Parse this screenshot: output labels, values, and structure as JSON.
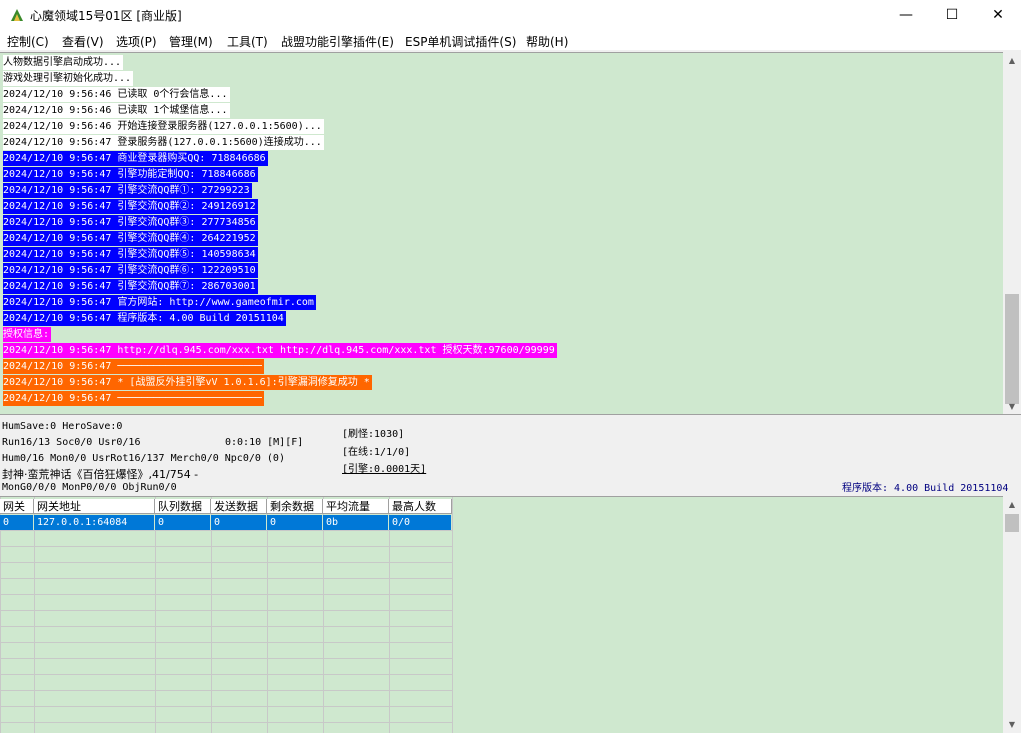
{
  "window": {
    "title": "心魔领域15号01区 [商业版]",
    "minimize": "—",
    "maximize": "☐",
    "close": "✕"
  },
  "menu": [
    "控制(C)",
    "查看(V)",
    "选项(P)",
    "管理(M)",
    "工具(T)",
    "战盟功能引擎插件(E)",
    "ESP单机调试插件(S)",
    "帮助(H)"
  ],
  "log": [
    {
      "text": "人物数据引擎启动成功...",
      "bg": "#ffffff",
      "fg": "#000000"
    },
    {
      "text": "游戏处理引擎初始化成功...",
      "bg": "#ffffff",
      "fg": "#000000"
    },
    {
      "text": "2024/12/10 9:56:46 已读取 0个行会信息...",
      "bg": "#ffffff",
      "fg": "#000000"
    },
    {
      "text": "2024/12/10 9:56:46 已读取 1个城堡信息...",
      "bg": "#ffffff",
      "fg": "#000000"
    },
    {
      "text": "2024/12/10 9:56:46 开始连接登录服务器(127.0.0.1:5600)...",
      "bg": "#ffffff",
      "fg": "#000000"
    },
    {
      "text": "2024/12/10 9:56:47 登录服务器(127.0.0.1:5600)连接成功...",
      "bg": "#ffffff",
      "fg": "#000000"
    },
    {
      "text": "2024/12/10 9:56:47 商业登录器购买QQ: 718846686",
      "bg": "#0000ff",
      "fg": "#ffffff"
    },
    {
      "text": "2024/12/10 9:56:47 引擎功能定制QQ: 718846686",
      "bg": "#0000ff",
      "fg": "#ffffff"
    },
    {
      "text": "2024/12/10 9:56:47 引擎交流QQ群①: 27299223",
      "bg": "#0000ff",
      "fg": "#ffffff"
    },
    {
      "text": "2024/12/10 9:56:47 引擎交流QQ群②: 249126912",
      "bg": "#0000ff",
      "fg": "#ffffff"
    },
    {
      "text": "2024/12/10 9:56:47 引擎交流QQ群③: 277734856",
      "bg": "#0000ff",
      "fg": "#ffffff"
    },
    {
      "text": "2024/12/10 9:56:47 引擎交流QQ群④: 264221952",
      "bg": "#0000ff",
      "fg": "#ffffff"
    },
    {
      "text": "2024/12/10 9:56:47 引擎交流QQ群⑤: 140598634",
      "bg": "#0000ff",
      "fg": "#ffffff"
    },
    {
      "text": "2024/12/10 9:56:47 引擎交流QQ群⑥: 122209510",
      "bg": "#0000ff",
      "fg": "#ffffff"
    },
    {
      "text": "2024/12/10 9:56:47 引擎交流QQ群⑦: 286703001",
      "bg": "#0000ff",
      "fg": "#ffffff"
    },
    {
      "text": "2024/12/10 9:56:47 官方网站: http://www.gameofmir.com",
      "bg": "#0000ff",
      "fg": "#ffffff"
    },
    {
      "text": "2024/12/10 9:56:47 程序版本: 4.00 Build 20151104",
      "bg": "#0000ff",
      "fg": "#ffffff"
    },
    {
      "text": "授权信息:",
      "bg": "#ff00ff",
      "fg": "#ffffff"
    },
    {
      "text": "2024/12/10 9:56:47 http://dlq.945.com/xxx.txt http://dlq.945.com/xxx.txt 授权天数:97600/99999",
      "bg": "#ff00ff",
      "fg": "#ffffff"
    },
    {
      "text": "2024/12/10 9:56:47 ────────────────────────",
      "bg": "#ff6600",
      "fg": "#ffffff"
    },
    {
      "text": "2024/12/10 9:56:47 * [战盟反外挂引擎vV 1.0.1.6]:引擎漏洞修复成功 *",
      "bg": "#ff6600",
      "fg": "#ffffff"
    },
    {
      "text": "2024/12/10 9:56:47 ────────────────────────",
      "bg": "#ff6600",
      "fg": "#ffffff"
    }
  ],
  "status": {
    "line1": "HumSave:0 HeroSave:0",
    "line2a": "Run16/13 Soc0/0 Usr0/16",
    "line2b": "0:0:10 [M][F]",
    "line3": "Hum0/16 Mon0/0 UsrRot16/137 Merch0/0 Npc0/0 (0)",
    "line4": "封神·蛮荒神话《百倍狂爆怪》,41/754 -",
    "line5": "MonG0/0/0 MonP0/0/0 ObjRun0/0",
    "refresh": "[刷怪:1030]",
    "online": "[在线:1/1/0]",
    "engine": "[引擎:0.0001天]",
    "version": "程序版本: 4.00 Build 20151104"
  },
  "grid": {
    "headers": [
      "网关",
      "网关地址",
      "队列数据",
      "发送数据",
      "剩余数据",
      "平均流量",
      "最高人数"
    ],
    "rows": [
      [
        "0",
        "127.0.0.1:64084",
        "0",
        "0",
        "0",
        "0b",
        "0/0"
      ]
    ]
  }
}
